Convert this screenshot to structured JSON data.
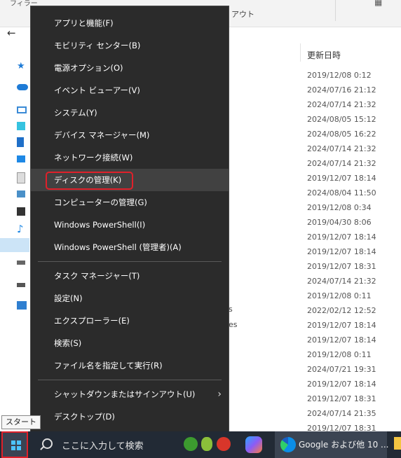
{
  "explorer": {
    "ribbon_text": "フィラー",
    "layout_label": "アウト",
    "view_icon": "grid-view-icon",
    "column_header": "更新日時",
    "dates": [
      "2019/12/08 0:12",
      "2024/07/16 21:12",
      "2024/07/14 21:32",
      "2024/08/05 15:12",
      "2024/08/05 16:22",
      "2024/07/14 21:32",
      "2024/07/14 21:32",
      "2019/12/07 18:14",
      "2024/08/04 11:50",
      "2019/12/08 0:34",
      "2019/04/30 8:06",
      "2019/12/07 18:14",
      "2019/12/07 18:14",
      "2019/12/07 18:31",
      "2024/07/14 21:32",
      "2019/12/08 0:11",
      "2022/02/12 12:52",
      "2019/12/07 18:14",
      "2019/12/07 18:14",
      "2019/12/08 0:11",
      "2024/07/21 19:31",
      "2019/12/07 18:14",
      "2019/12/07 18:31",
      "2024/07/14 21:35",
      "2019/12/07 18:31"
    ],
    "partial_names": [
      "s",
      "es"
    ]
  },
  "menu": {
    "groups": [
      [
        "アプリと機能(F)",
        "モビリティ センター(B)",
        "電源オプション(O)",
        "イベント ビューアー(V)",
        "システム(Y)",
        "デバイス マネージャー(M)",
        "ネットワーク接続(W)",
        "ディスクの管理(K)",
        "コンピューターの管理(G)",
        "Windows PowerShell(I)",
        "Windows PowerShell (管理者)(A)"
      ],
      [
        "タスク マネージャー(T)",
        "設定(N)",
        "エクスプローラー(E)",
        "検索(S)",
        "ファイル名を指定して実行(R)"
      ],
      [
        "シャットダウンまたはサインアウト(U)",
        "デスクトップ(D)"
      ]
    ],
    "highlighted": "ディスクの管理(K)",
    "submenu_icon": "chevron-right-icon"
  },
  "taskbar": {
    "tooltip": "スタート",
    "search_placeholder": "ここに入力して検索",
    "edge_label": "Google および他 10 ...",
    "accent": "#e0202a"
  }
}
